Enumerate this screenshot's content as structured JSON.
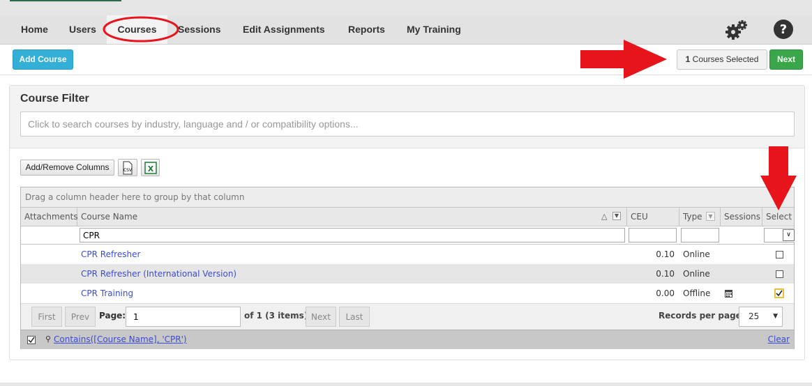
{
  "nav": {
    "items": [
      {
        "label": "Home"
      },
      {
        "label": "Users"
      },
      {
        "label": "Courses"
      },
      {
        "label": "Sessions"
      },
      {
        "label": "Edit Assignments"
      },
      {
        "label": "Reports"
      },
      {
        "label": "My Training"
      }
    ],
    "active": "Courses",
    "icons": [
      "gears-icon",
      "help-icon"
    ]
  },
  "toolbar": {
    "add_course_label": "Add Course",
    "selected_count": "1",
    "selected_text": "Courses Selected",
    "next_label": "Next"
  },
  "filter": {
    "title": "Course Filter",
    "placeholder": "Click to search courses by industry, language and / or compatibility options..."
  },
  "grid_tools": {
    "add_remove_columns_label": "Add/Remove Columns",
    "csv_icon": "csv-export-icon",
    "excel_icon": "excel-export-icon"
  },
  "grid": {
    "group_hint": "Drag a column header here to group by that column",
    "columns": [
      "Attachments",
      "Course Name",
      "CEU",
      "Type",
      "Sessions",
      "Select"
    ],
    "course_name_filter": "CPR",
    "rows": [
      {
        "name": "CPR Refresher",
        "ceu": "0.10",
        "type": "Online",
        "has_sessions": false,
        "selected": false
      },
      {
        "name": "CPR Refresher (International Version)",
        "ceu": "0.10",
        "type": "Online",
        "has_sessions": false,
        "selected": false
      },
      {
        "name": "CPR Training",
        "ceu": "0.00",
        "type": "Offline",
        "has_sessions": true,
        "selected": true
      }
    ]
  },
  "pager": {
    "first_label": "First",
    "prev_label": "Prev",
    "page_label": "Page:",
    "page_value": "1",
    "of_text": "of 1 (3 items)",
    "next_label": "Next",
    "last_label": "Last",
    "records_label": "Records per page:",
    "records_value": "25"
  },
  "footer_filter": {
    "expression": "Contains([Course Name], 'CPR')",
    "clear_label": "Clear"
  },
  "colors": {
    "add_course_bg": "#33afd8",
    "next_bg": "#3aa64a",
    "annotation_red": "#e8141c",
    "link": "#3b4bd6"
  }
}
